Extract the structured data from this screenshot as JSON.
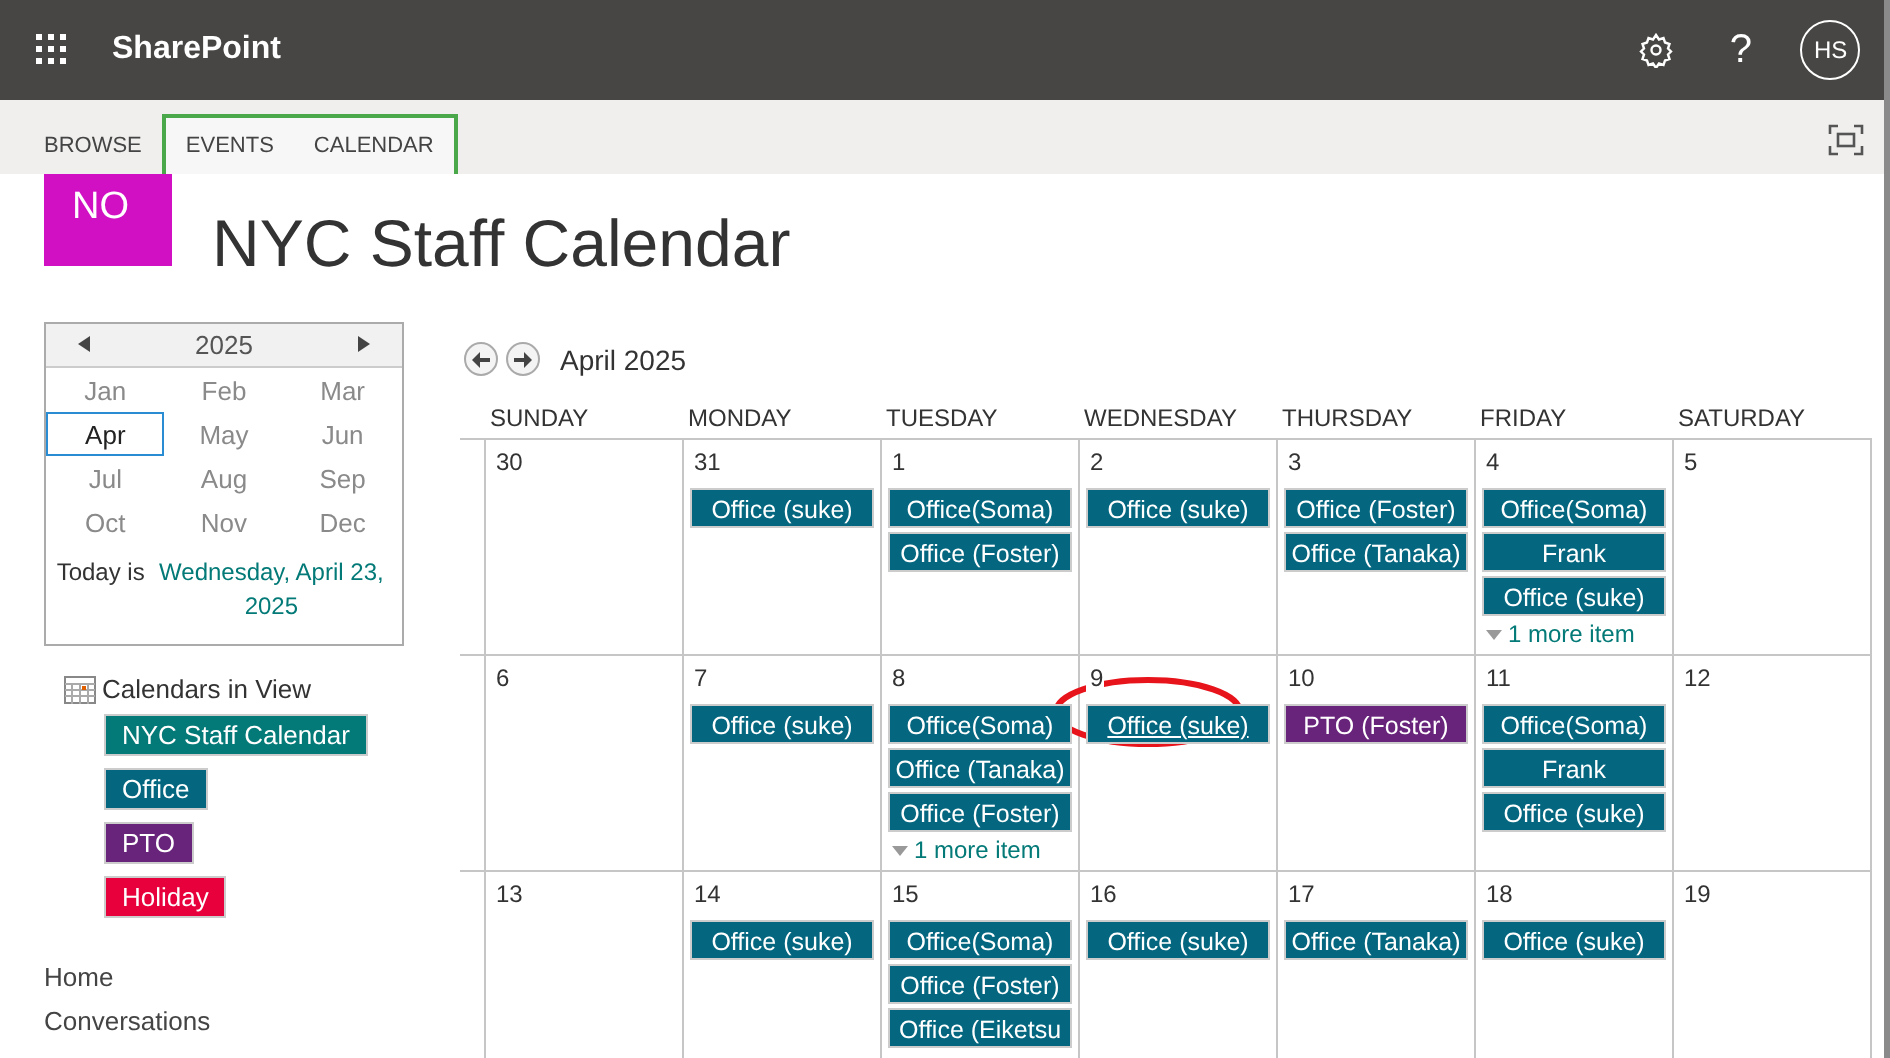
{
  "suite_bar": {
    "app_name": "SharePoint",
    "help": "?",
    "avatar": "HS"
  },
  "ribbon": {
    "tabs": [
      {
        "label": "BROWSE",
        "selected": false,
        "contextual": false
      },
      {
        "label": "EVENTS",
        "selected": false,
        "contextual": true
      },
      {
        "label": "CALENDAR",
        "selected": false,
        "contextual": true
      }
    ]
  },
  "site": {
    "logo": "NO",
    "title": "NYC Staff Calendar"
  },
  "date_picker": {
    "year": "2025",
    "months": [
      {
        "label": "Jan",
        "selected": false
      },
      {
        "label": "Feb",
        "selected": false
      },
      {
        "label": "Mar",
        "selected": false
      },
      {
        "label": "Apr",
        "selected": true
      },
      {
        "label": "May",
        "selected": false
      },
      {
        "label": "Jun",
        "selected": false
      },
      {
        "label": "Jul",
        "selected": false
      },
      {
        "label": "Aug",
        "selected": false
      },
      {
        "label": "Sep",
        "selected": false
      },
      {
        "label": "Oct",
        "selected": false
      },
      {
        "label": "Nov",
        "selected": false
      },
      {
        "label": "Dec",
        "selected": false
      }
    ],
    "today_prefix": "Today is",
    "today_link": "Wednesday, April 23, 2025"
  },
  "calendars_in_view": {
    "title": "Calendars in View",
    "items": [
      {
        "label": "NYC Staff Calendar",
        "color": "#037a77"
      },
      {
        "label": "Office",
        "color": "#04677f"
      },
      {
        "label": "PTO",
        "color": "#68237b"
      },
      {
        "label": "Holiday",
        "color": "#e8003c"
      }
    ]
  },
  "nav": [
    "Home",
    "Conversations"
  ],
  "calendar": {
    "month": "April 2025",
    "weekdays": [
      "SUNDAY",
      "MONDAY",
      "TUESDAY",
      "WEDNESDAY",
      "THURSDAY",
      "FRIDAY",
      "SATURDAY"
    ],
    "weeks": [
      {
        "days": [
          {
            "date": "30"
          },
          {
            "date": "31",
            "events": [
              {
                "title": "Office (suke)",
                "color": "#04677f",
                "hovered": false
              }
            ]
          },
          {
            "date": "1",
            "events": [
              {
                "title": "Office(Soma)",
                "color": "#04677f",
                "hovered": false
              },
              {
                "title": "Office (Foster)",
                "color": "#04677f",
                "hovered": false
              }
            ]
          },
          {
            "date": "2",
            "events": [
              {
                "title": "Office (suke)",
                "color": "#04677f",
                "hovered": false
              }
            ]
          },
          {
            "date": "3",
            "events": [
              {
                "title": "Office (Foster)",
                "color": "#04677f",
                "hovered": false
              },
              {
                "title": "Office (Tanaka)",
                "color": "#04677f",
                "hovered": false
              }
            ]
          },
          {
            "date": "4",
            "events": [
              {
                "title": "Office(Soma)",
                "color": "#04677f",
                "hovered": false
              },
              {
                "title": "Frank",
                "color": "#04677f",
                "hovered": false
              },
              {
                "title": "Office (suke)",
                "color": "#04677f",
                "hovered": false
              }
            ],
            "more": "1 more item"
          },
          {
            "date": "5"
          }
        ]
      },
      {
        "days": [
          {
            "date": "6"
          },
          {
            "date": "7",
            "events": [
              {
                "title": "Office (suke)",
                "color": "#04677f",
                "hovered": false
              }
            ]
          },
          {
            "date": "8",
            "events": [
              {
                "title": "Office(Soma)",
                "color": "#04677f",
                "hovered": false
              },
              {
                "title": "Office (Tanaka)",
                "color": "#04677f",
                "hovered": false
              },
              {
                "title": "Office (Foster)",
                "color": "#04677f",
                "hovered": false
              }
            ],
            "more": "1 more item"
          },
          {
            "date": "9",
            "events": [
              {
                "title": "Office (suke)",
                "color": "#04677f",
                "hovered": true
              }
            ],
            "annotation": {
              "kind": "ellipse"
            }
          },
          {
            "date": "10",
            "events": [
              {
                "title": "PTO (Foster)",
                "color": "#68237b",
                "hovered": false
              }
            ]
          },
          {
            "date": "11",
            "events": [
              {
                "title": "Office(Soma)",
                "color": "#04677f",
                "hovered": false
              },
              {
                "title": "Frank",
                "color": "#04677f",
                "hovered": false
              },
              {
                "title": "Office (suke)",
                "color": "#04677f",
                "hovered": false
              }
            ]
          },
          {
            "date": "12"
          }
        ]
      },
      {
        "days": [
          {
            "date": "13"
          },
          {
            "date": "14",
            "events": [
              {
                "title": "Office (suke)",
                "color": "#04677f",
                "hovered": false
              }
            ]
          },
          {
            "date": "15",
            "events": [
              {
                "title": "Office(Soma)",
                "color": "#04677f",
                "hovered": false
              },
              {
                "title": "Office (Foster)",
                "color": "#04677f",
                "hovered": false
              },
              {
                "title": "Office (Eiketsu",
                "color": "#04677f",
                "hovered": false
              }
            ]
          },
          {
            "date": "16",
            "events": [
              {
                "title": "Office (suke)",
                "color": "#04677f",
                "hovered": false
              }
            ]
          },
          {
            "date": "17",
            "events": [
              {
                "title": "Office (Tanaka)",
                "color": "#04677f",
                "hovered": false
              }
            ]
          },
          {
            "date": "18",
            "events": [
              {
                "title": "Office (suke)",
                "color": "#04677f",
                "hovered": false
              }
            ]
          },
          {
            "date": "19"
          }
        ]
      }
    ]
  }
}
